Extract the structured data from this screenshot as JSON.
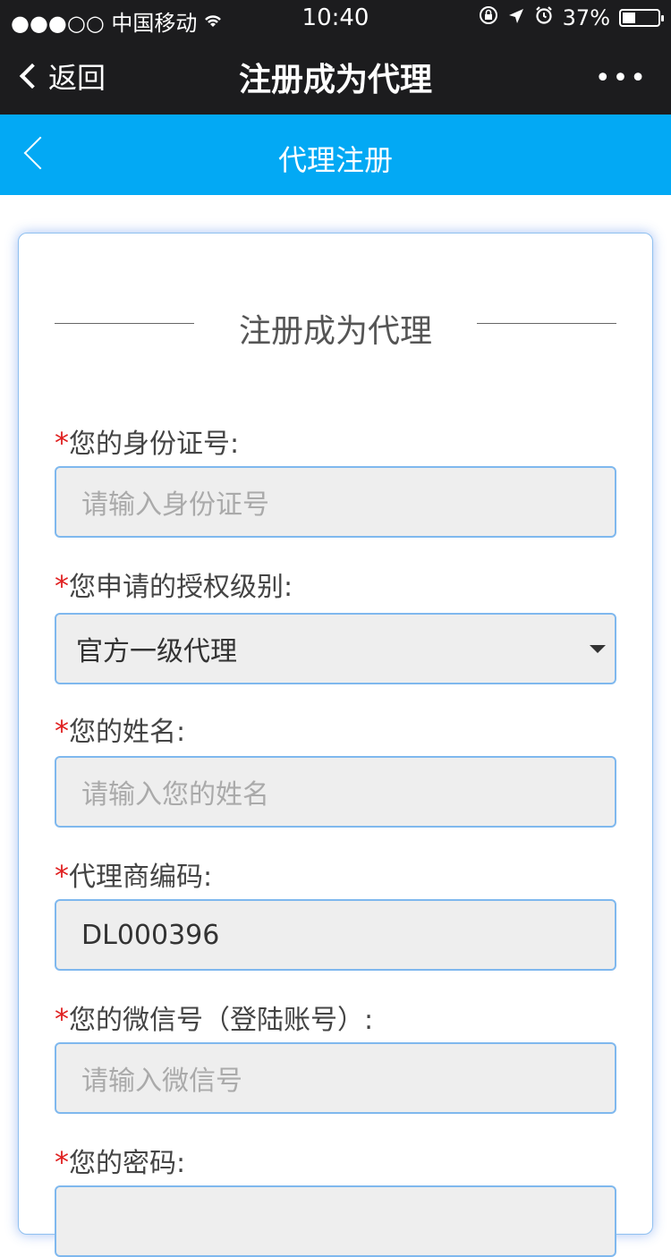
{
  "status_bar": {
    "carrier": "●●●○○ 中国移动",
    "time": "10:40",
    "battery_percent": "37%",
    "battery_level": 0.37
  },
  "wechat_nav": {
    "back_label": "返回",
    "title": "注册成为代理",
    "more": "•••"
  },
  "header": {
    "title": "代理注册"
  },
  "form": {
    "section_title": "注册成为代理",
    "fields": [
      {
        "label": "您的身份证号:",
        "placeholder": "请输入身份证号"
      },
      {
        "label": "您申请的授权级别:",
        "value": "官方一级代理"
      },
      {
        "label": "您的姓名:",
        "placeholder": "请输入您的姓名"
      },
      {
        "label": "代理商编码:",
        "value": "DL000396"
      },
      {
        "label": "您的微信号（登陆账号）:",
        "placeholder": "请输入微信号"
      },
      {
        "label": "您的密码:",
        "placeholder": ""
      }
    ],
    "required_mark": "*"
  }
}
